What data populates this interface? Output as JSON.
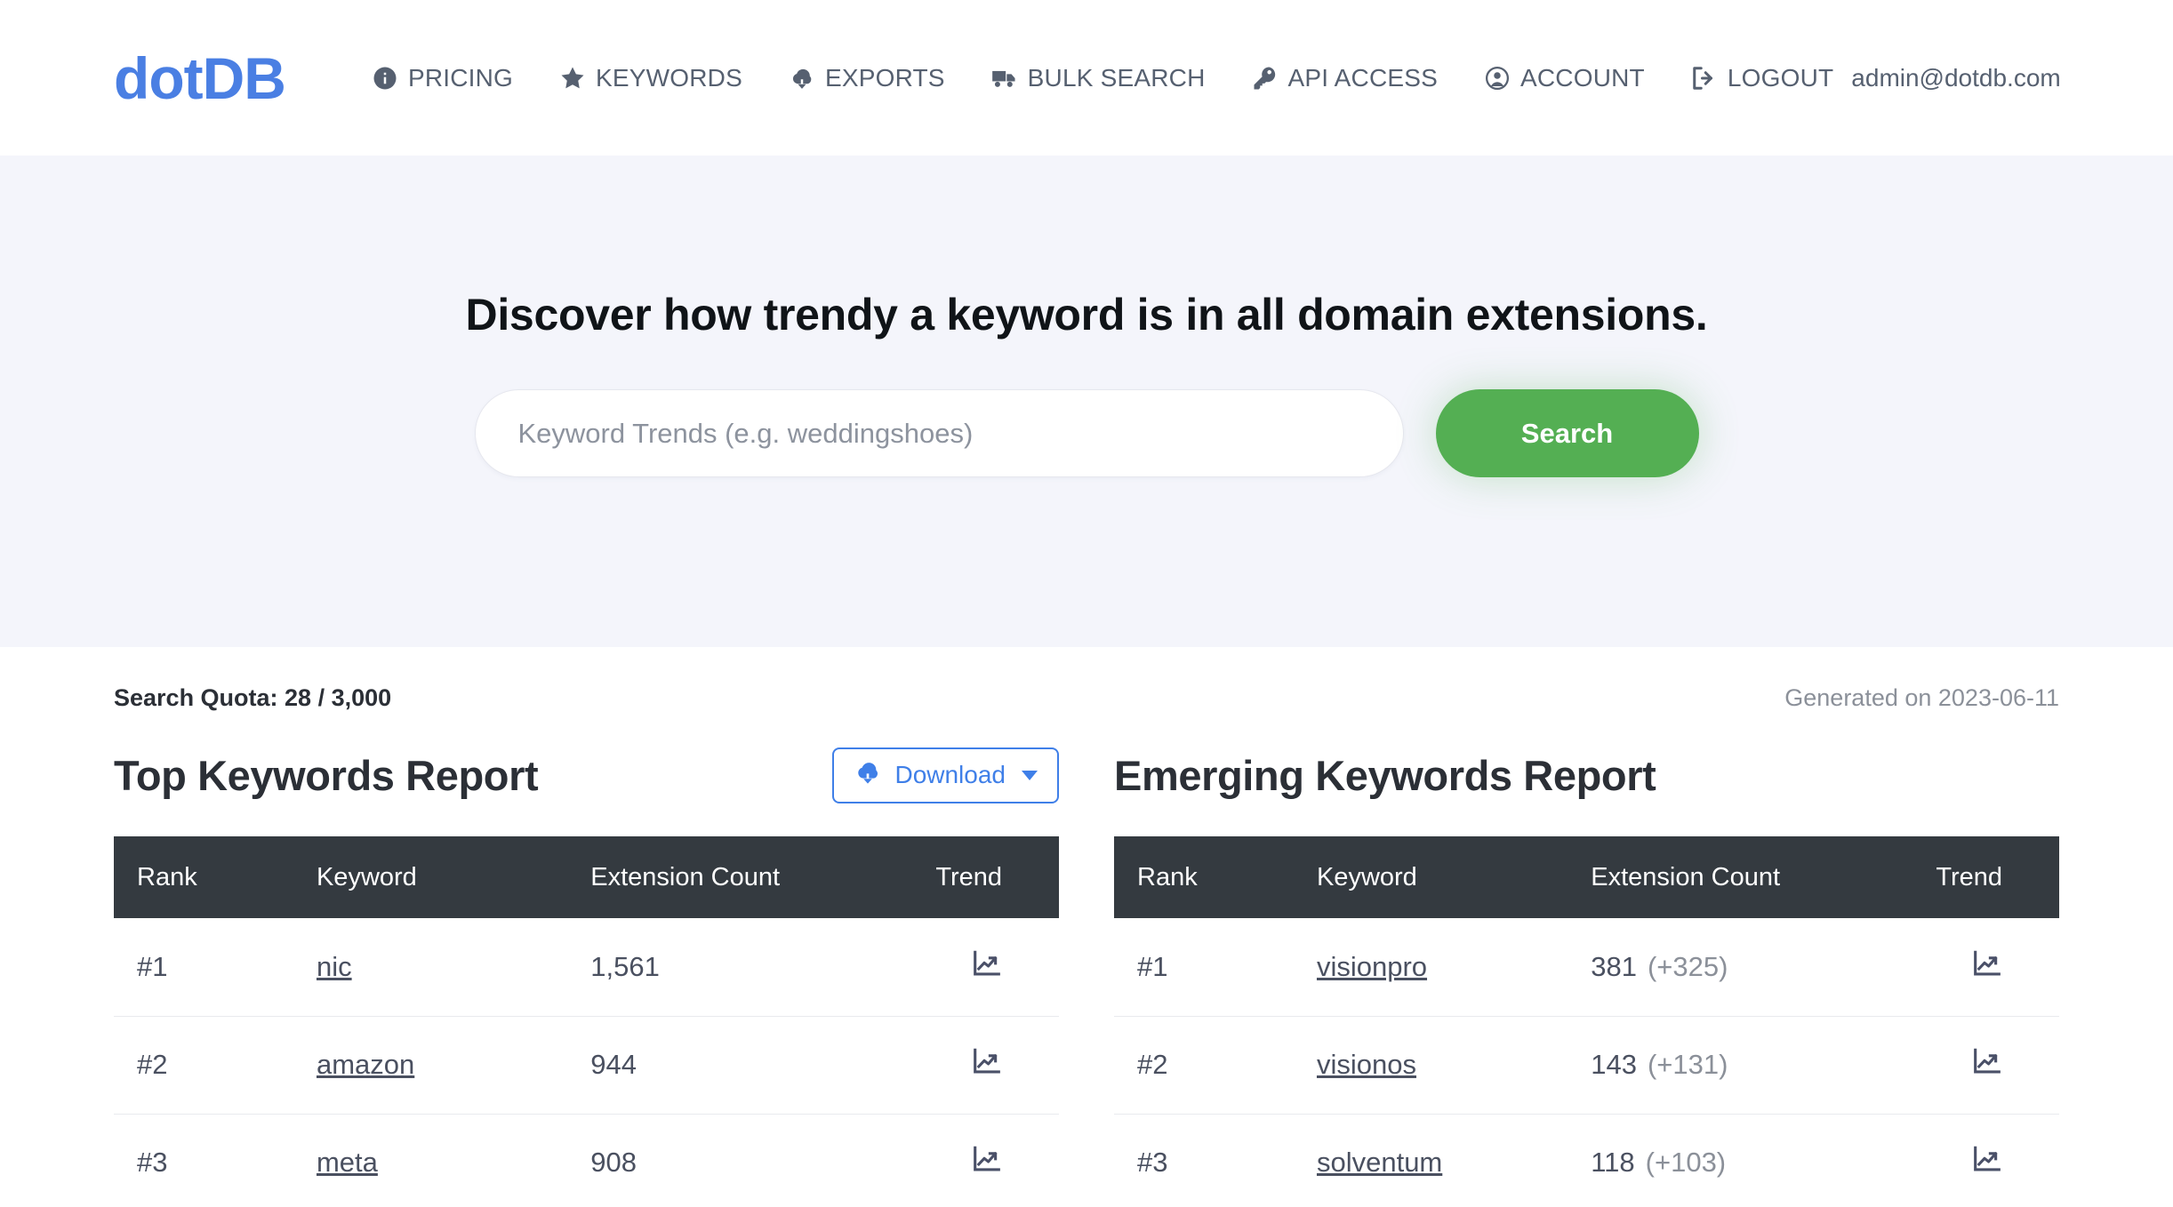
{
  "brand": {
    "logo": "dotDB",
    "color": "#4a7fe3"
  },
  "nav": {
    "items": [
      {
        "icon": "info-circle-icon",
        "label": "PRICING"
      },
      {
        "icon": "star-icon",
        "label": "KEYWORDS"
      },
      {
        "icon": "cloud-download-icon",
        "label": "EXPORTS"
      },
      {
        "icon": "truck-icon",
        "label": "BULK SEARCH"
      },
      {
        "icon": "key-icon",
        "label": "API ACCESS"
      },
      {
        "icon": "user-circle-icon",
        "label": "ACCOUNT"
      },
      {
        "icon": "sign-out-icon",
        "label": "LOGOUT"
      }
    ],
    "user_email": "admin@dotdb.com"
  },
  "hero": {
    "title": "Discover how trendy a keyword is in all domain extensions.",
    "search_placeholder": "Keyword Trends (e.g. weddingshoes)",
    "search_value": "",
    "search_button": "Search",
    "search_button_color": "#54af53"
  },
  "meta": {
    "quota": "Search Quota: 28 / 3,000",
    "generated": "Generated on 2023-06-11"
  },
  "reports": {
    "left": {
      "title": "Top Keywords Report",
      "download_label": "Download",
      "columns": [
        "Rank",
        "Keyword",
        "Extension Count",
        "Trend"
      ],
      "rows": [
        {
          "rank": "#1",
          "keyword": "nic",
          "count": "1,561",
          "delta": "",
          "trend": "chart-line-up-icon"
        },
        {
          "rank": "#2",
          "keyword": "amazon",
          "count": "944",
          "delta": "",
          "trend": "chart-line-up-icon"
        },
        {
          "rank": "#3",
          "keyword": "meta",
          "count": "908",
          "delta": "",
          "trend": "chart-line-up-icon"
        }
      ]
    },
    "right": {
      "title": "Emerging Keywords Report",
      "columns": [
        "Rank",
        "Keyword",
        "Extension Count",
        "Trend"
      ],
      "rows": [
        {
          "rank": "#1",
          "keyword": "visionpro",
          "count": "381",
          "delta": "(+325)",
          "trend": "chart-line-up-icon"
        },
        {
          "rank": "#2",
          "keyword": "visionos",
          "count": "143",
          "delta": "(+131)",
          "trend": "chart-line-up-icon"
        },
        {
          "rank": "#3",
          "keyword": "solventum",
          "count": "118",
          "delta": "(+103)",
          "trend": "chart-line-up-icon"
        }
      ]
    }
  }
}
